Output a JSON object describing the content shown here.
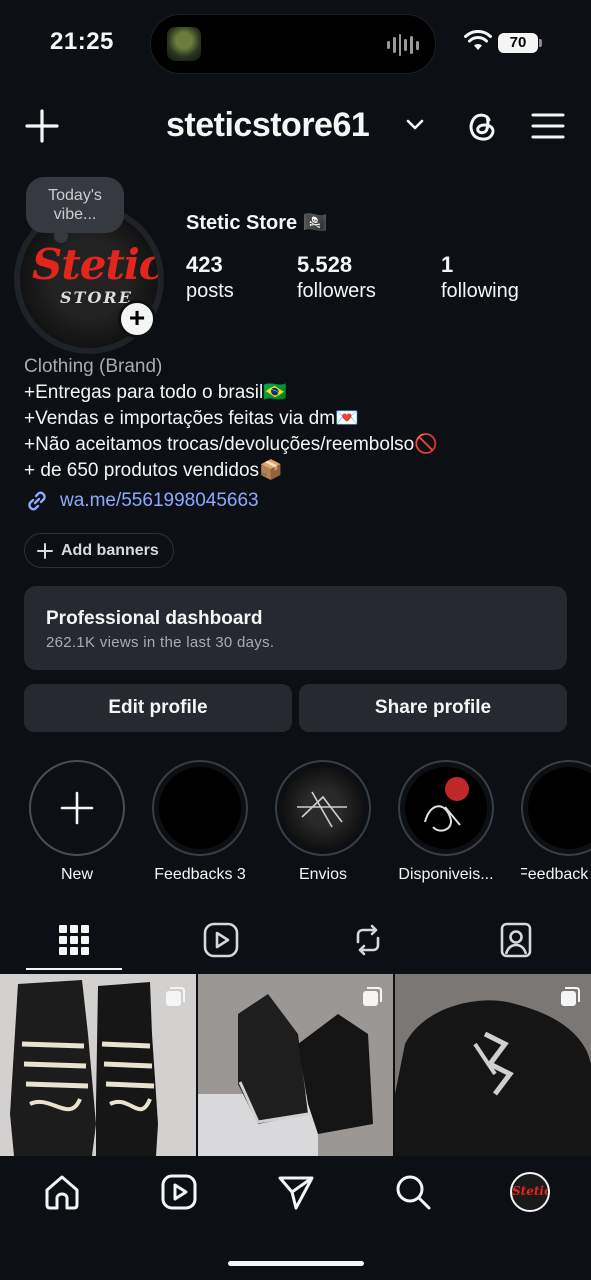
{
  "status_bar": {
    "time": "21:25",
    "battery": "70"
  },
  "header": {
    "username": "steticstore61"
  },
  "profile": {
    "note": "Today's vibe...",
    "display_name": "Stetic Store 🏴‍☠️",
    "avatar_logo_top": "Stetic",
    "avatar_logo_bottom": "STORE",
    "stats": [
      {
        "value": "423",
        "label": "posts"
      },
      {
        "value": "5.528",
        "label": "followers"
      },
      {
        "value": "1",
        "label": "following"
      }
    ],
    "category": "Clothing (Brand)",
    "bio_lines": [
      "+Entregas para todo o brasil🇧🇷",
      "+Vendas e importações feitas via dm💌",
      "+Não aceitamos trocas/devoluções/reembolso🚫",
      "+ de 650 produtos vendidos📦"
    ],
    "link": "wa.me/5561998045663"
  },
  "add_banners_label": "Add banners",
  "dashboard": {
    "title": "Professional dashboard",
    "subtitle": "262.1K views in the last 30 days."
  },
  "buttons": {
    "edit": "Edit profile",
    "share": "Share profile"
  },
  "highlights": [
    {
      "label": "New"
    },
    {
      "label": "Feedbacks 3"
    },
    {
      "label": "Envios"
    },
    {
      "label": "Disponiveis..."
    },
    {
      "label": "Feedback"
    }
  ],
  "tabs": [
    "grid-icon",
    "reels-icon",
    "reposts-icon",
    "tagged-icon"
  ],
  "bottom_nav": [
    "home-icon",
    "reels-icon",
    "send-icon",
    "search-icon",
    "profile-avatar"
  ],
  "colors": {
    "background": "#0c1014",
    "card": "#262a30",
    "link": "#8ea8ff",
    "brand_red": "#e2261e"
  }
}
